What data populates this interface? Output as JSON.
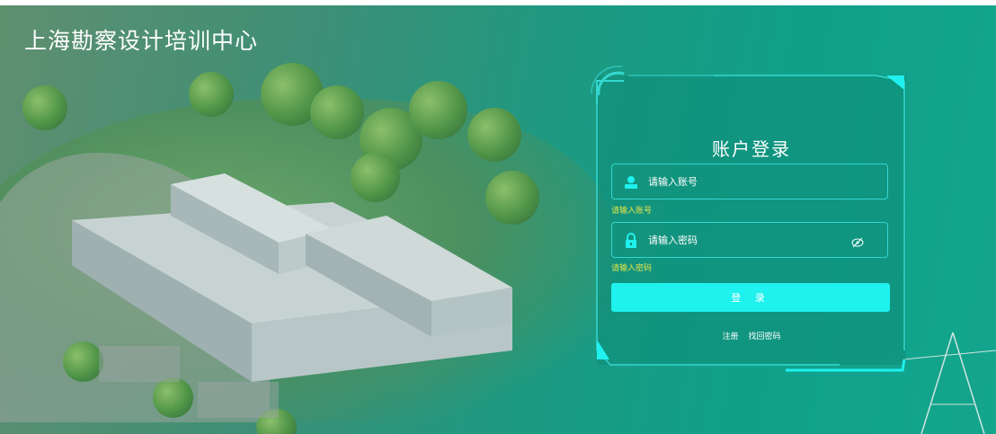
{
  "app": {
    "title": "上海勘察设计培训中心"
  },
  "login": {
    "heading": "账户登录",
    "account": {
      "placeholder": "请输入账号",
      "hint": "请输入账号"
    },
    "password": {
      "placeholder": "请输入密码",
      "hint": "请输入密码"
    },
    "submit_label": "登 录",
    "register_label": "注册",
    "forgot_label": "找回密码"
  },
  "colors": {
    "accent": "#1ff1ee",
    "frame": "#35d7d0",
    "hint": "#e6e64a"
  }
}
